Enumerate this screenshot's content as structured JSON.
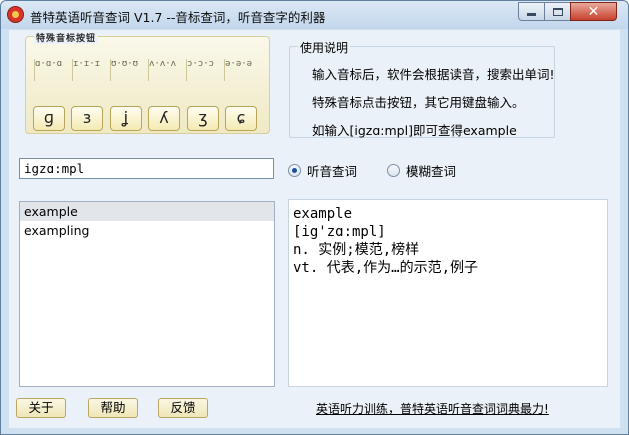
{
  "window": {
    "title": "普特英语听音查词 V1.7 --音标查词，听音查字的利器"
  },
  "keyboard": {
    "legend": "特殊音标按钮",
    "scribbles": [
      "ɑ·ɑ·ɑ",
      "ɪ·ɪ·ɪ",
      "ʊ·ʊ·ʊ",
      "ʌ·ʌ·ʌ",
      "ɔ·ɔ·ɔ",
      "ə·ə·ə"
    ],
    "keys": [
      "ɡ",
      "ɜ",
      "ʝ",
      "ʎ",
      "ʒ",
      "ɕ"
    ]
  },
  "usage": {
    "title": "使用说明",
    "lines": [
      "输入音标后，软件会根据读音，搜索出单词!",
      "特殊音标点击按钮，其它用键盘输入。",
      "如输入[igzɑ:mpl]即可查得example"
    ]
  },
  "search": {
    "value": "igzɑ:mpl"
  },
  "modes": {
    "listen_label": "听音查词",
    "fuzzy_label": "模糊查词",
    "selected": "listen"
  },
  "word_list": {
    "items": [
      "example",
      "exampling"
    ],
    "selected_index": 0
  },
  "definition": {
    "lines": [
      "example",
      "[ig'zɑ:mpl]",
      "n. 实例;模范,榜样",
      "vt. 代表,作为…的示范,例子"
    ]
  },
  "footer": {
    "about_label": "关于",
    "help_label": "帮助",
    "feedback_label": "反馈",
    "promo_text": "英语听力训练，普特英语听音查词词典最力!"
  }
}
